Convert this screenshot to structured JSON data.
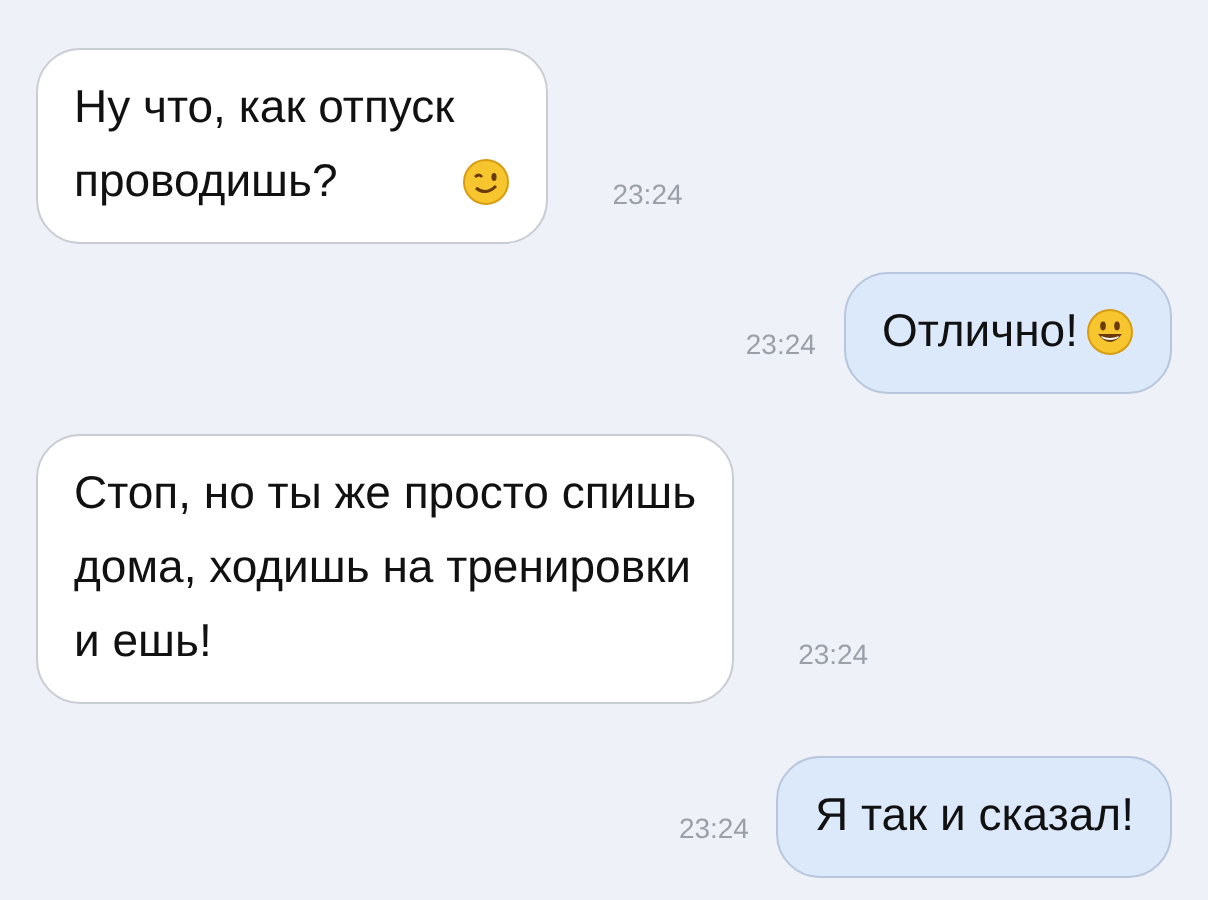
{
  "messages": [
    {
      "outgoing": false,
      "kind": "wink-emoji",
      "lines": [
        "Ну что, как отпуск",
        "проводишь?"
      ],
      "time": "23:24"
    },
    {
      "outgoing": true,
      "kind": "smile-emoji",
      "lines": [
        "Отлично!"
      ],
      "time": "23:24"
    },
    {
      "outgoing": false,
      "kind": "text",
      "lines": [
        "Стоп, но ты же просто спишь",
        "дома, ходишь на тренировки",
        "и ешь!"
      ],
      "time": "23:24"
    },
    {
      "outgoing": true,
      "kind": "text",
      "lines": [
        "Я так и сказал!"
      ],
      "time": "23:24"
    }
  ]
}
